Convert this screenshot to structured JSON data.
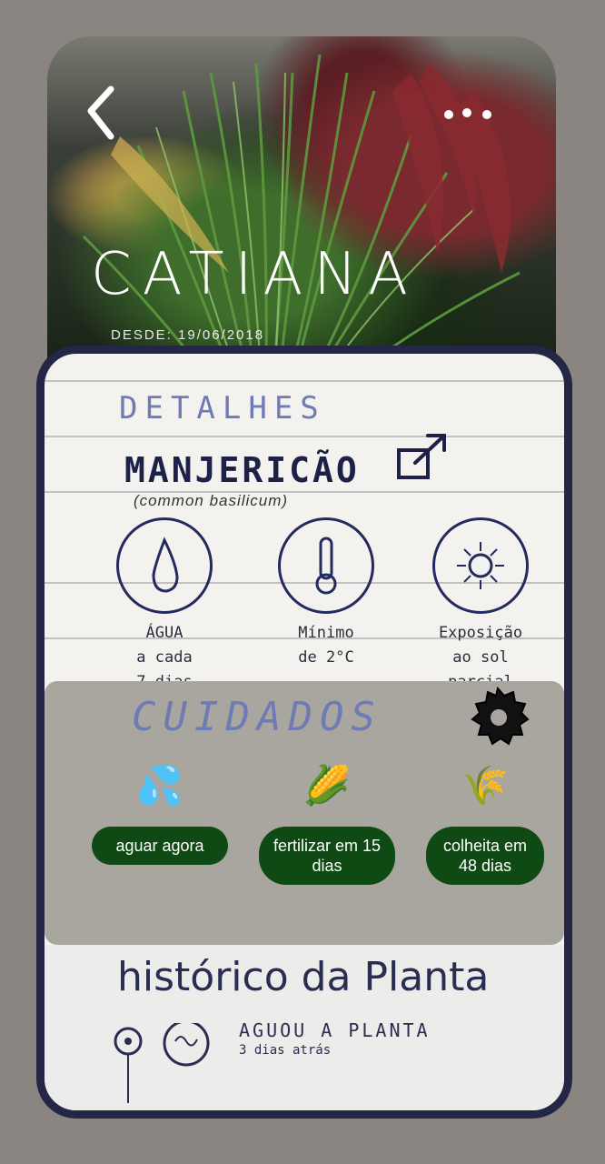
{
  "header": {
    "back_icon": "chevron-left-icon",
    "more_icon": "more-dots-icon",
    "plant_name": "CATIANA",
    "since": "DESDE: 19/06/2018"
  },
  "details": {
    "title": "DETALHES",
    "species": "MANJERICÃO",
    "scientific_name": "(common basilicum)",
    "link_icon": "external-link-icon",
    "items": [
      {
        "icon": "water-drop-icon",
        "label_line1": "ÁGUA",
        "label_line2": "a cada",
        "label_line3": "7 dias"
      },
      {
        "icon": "thermometer-icon",
        "label_line1": "Mínimo",
        "label_line2": "de 2°C"
      },
      {
        "icon": "sun-icon",
        "label_line1": "Exposição",
        "label_line2": "ao sol parcial"
      }
    ]
  },
  "care": {
    "title": "CUIDADOS",
    "settings_icon": "gear-icon",
    "tasks": [
      {
        "emoji": "💦",
        "icon": "water-splash-icon",
        "label": "aguar agora"
      },
      {
        "emoji": "🌽",
        "icon": "corn-icon",
        "label": "fertilizar em 15 dias"
      },
      {
        "emoji": "🌾",
        "icon": "wheat-icon",
        "label": "colheita em 48 dias"
      }
    ]
  },
  "history": {
    "title": "histórico da Planta",
    "entries": [
      {
        "title": "AGUOU A PLANTA",
        "time": "3 dias atrás"
      }
    ]
  },
  "colors": {
    "accent": "#6f7bb5",
    "border": "#232745",
    "pill": "#0f4a15"
  }
}
